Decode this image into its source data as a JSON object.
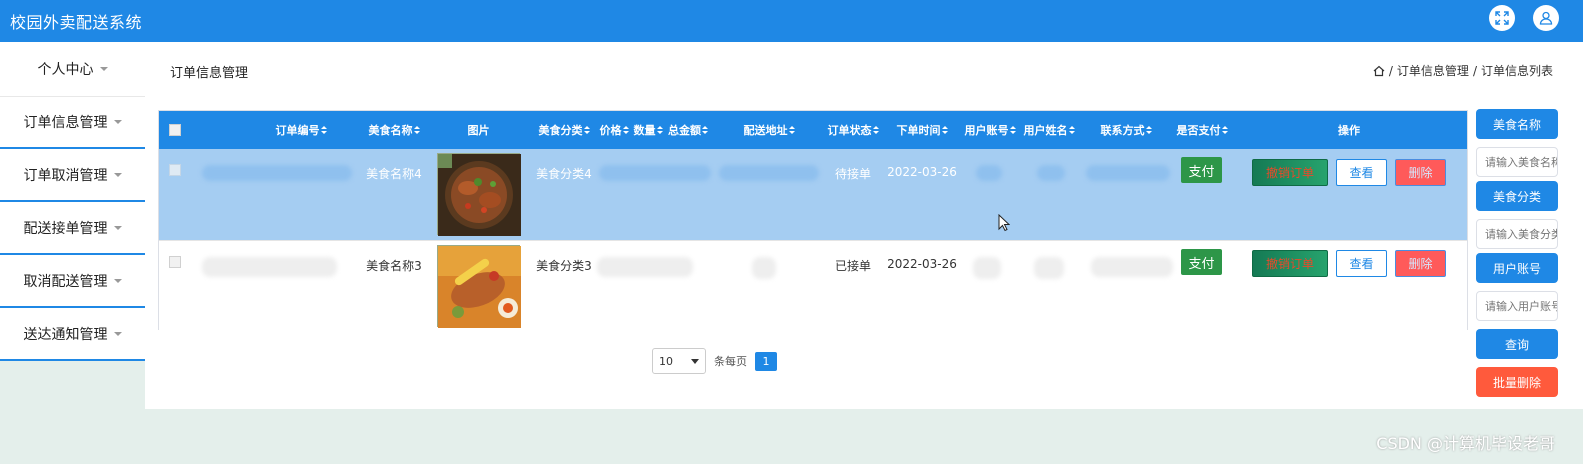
{
  "app": {
    "title": "校园外卖配送系统"
  },
  "header": {
    "icons": [
      "fullscreen-icon",
      "user-icon"
    ]
  },
  "sidebar": {
    "personal": "个人中心",
    "items": [
      {
        "label": "订单信息管理"
      },
      {
        "label": "订单取消管理"
      },
      {
        "label": "配送接单管理"
      },
      {
        "label": "取消配送管理"
      },
      {
        "label": "送达通知管理"
      }
    ]
  },
  "page": {
    "title": "订单信息管理",
    "breadcrumb": [
      "订单信息管理",
      "订单信息列表"
    ],
    "breadcrumb_sep": "/"
  },
  "table": {
    "columns": {
      "order_no": "订单编号",
      "food_name": "美食名称",
      "image": "图片",
      "category": "美食分类",
      "price": "价格",
      "quantity": "数量",
      "total": "总金额",
      "address": "配送地址",
      "status": "订单状态",
      "order_time": "下单时间",
      "account": "用户账号",
      "username": "用户姓名",
      "contact": "联系方式",
      "paid": "是否支付",
      "actions": "操作"
    },
    "rows": [
      {
        "food_name": "美食名称4",
        "category": "美食分类4",
        "status": "待接单",
        "order_time": "2022-03-26"
      },
      {
        "food_name": "美食名称3",
        "category": "美食分类3",
        "status": "已接单",
        "order_time": "2022-03-26"
      }
    ],
    "buttons": {
      "pay": "支付",
      "cancel": "撤销订单",
      "view": "查看",
      "delete": "删除"
    }
  },
  "pagination": {
    "page_size": "10",
    "per_page_label": "条每页",
    "current_page": "1"
  },
  "search": {
    "food_name_label": "美食名称",
    "food_name_placeholder": "请输入美食名称",
    "category_label": "美食分类",
    "category_placeholder": "请输入美食分类",
    "account_label": "用户账号",
    "account_placeholder": "请输入用户账号",
    "query": "查询",
    "batch_delete": "批量删除"
  },
  "watermark": "CSDN @计算机毕设老哥",
  "colors": {
    "primary": "#1f88e5",
    "selected_row": "#a5cdf2",
    "pay": "#2d9648",
    "danger": "#ff5a5a"
  }
}
